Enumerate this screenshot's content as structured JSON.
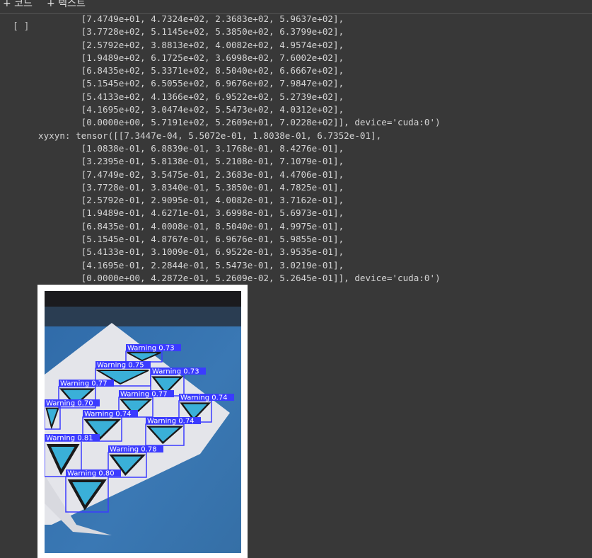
{
  "toolbar": {
    "add_code": "+ 코드",
    "add_text": "+ 텍스트"
  },
  "cell": {
    "run_indicator": "[ ]"
  },
  "output_lines": [
    "        [7.4749e+01, 4.7324e+02, 2.3683e+02, 5.9637e+02],",
    "        [3.7728e+02, 5.1145e+02, 5.3850e+02, 6.3799e+02],",
    "        [2.5792e+02, 3.8813e+02, 4.0082e+02, 4.9574e+02],",
    "        [1.9489e+02, 6.1725e+02, 3.6998e+02, 7.6002e+02],",
    "        [6.8435e+02, 5.3371e+02, 8.5040e+02, 6.6667e+02],",
    "        [5.1545e+02, 6.5055e+02, 6.9676e+02, 7.9847e+02],",
    "        [5.4133e+02, 4.1366e+02, 6.9522e+02, 5.2739e+02],",
    "        [4.1695e+02, 3.0474e+02, 5.5473e+02, 4.0312e+02],",
    "        [0.0000e+00, 5.7191e+02, 5.2609e+01, 7.0228e+02]], device='cuda:0')",
    "xyxyn: tensor([[7.3447e-04, 5.5072e-01, 1.8038e-01, 6.7352e-01],",
    "        [1.0838e-01, 6.8839e-01, 3.1768e-01, 8.4276e-01],",
    "        [3.2395e-01, 5.8138e-01, 5.2108e-01, 7.1079e-01],",
    "        [7.4749e-02, 3.5475e-01, 2.3683e-01, 4.4706e-01],",
    "        [3.7728e-01, 3.8340e-01, 5.3850e-01, 4.7825e-01],",
    "        [2.5792e-01, 2.9095e-01, 4.0082e-01, 3.7162e-01],",
    "        [1.9489e-01, 4.6271e-01, 3.6998e-01, 5.6973e-01],",
    "        [6.8435e-01, 4.0008e-01, 8.5040e-01, 4.9975e-01],",
    "        [5.1545e-01, 4.8767e-01, 6.9676e-01, 5.9855e-01],",
    "        [5.4133e-01, 3.1009e-01, 6.9522e-01, 3.9535e-01],",
    "        [4.1695e-01, 2.2844e-01, 5.5473e-01, 3.0219e-01],",
    "        [0.0000e+00, 4.2872e-01, 5.2609e-02, 5.2645e-01]], device='cuda:0')"
  ],
  "detections": [
    {
      "label": "Warning 0.73"
    },
    {
      "label": "Warning 0.75"
    },
    {
      "label": "Warning 0.73"
    },
    {
      "label": "Warning 0.77"
    },
    {
      "label": "Warning 0.77"
    },
    {
      "label": "Warning 0.74"
    },
    {
      "label": "Warning 0.70"
    },
    {
      "label": "Warning 0.74"
    },
    {
      "label": "Warning 0.74"
    },
    {
      "label": "Warning 0.81"
    },
    {
      "label": "Warning 0.78"
    },
    {
      "label": "Warning 0.80"
    }
  ],
  "colors": {
    "bg": "#383838",
    "text": "#d4d4d4",
    "box": "#3b3bff",
    "table": "#3a6ea8",
    "paper": "#e6e6ea",
    "sign": "#3ab0d8"
  }
}
